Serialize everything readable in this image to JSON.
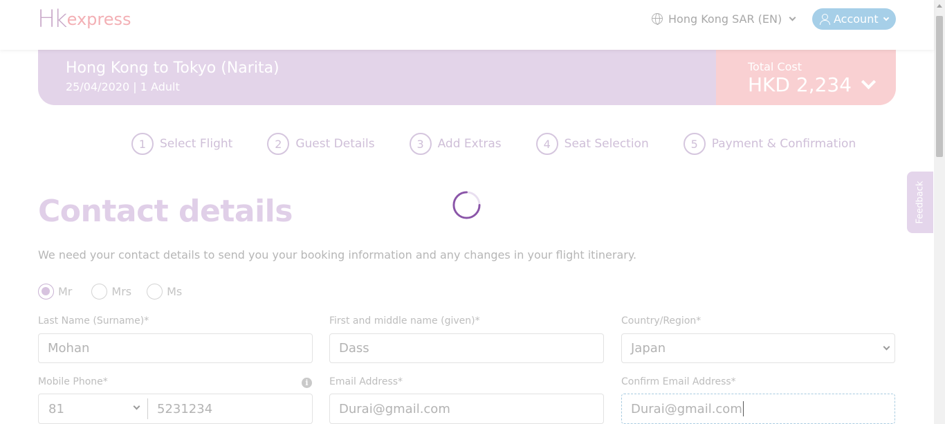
{
  "header": {
    "logo_hk": "Hk",
    "logo_express": "express",
    "region_label": "Hong Kong SAR (EN)",
    "account_label": "Account"
  },
  "trip": {
    "route": "Hong Kong to Tokyo (Narita)",
    "meta": "25/04/2020 | 1 Adult",
    "total_label": "Total Cost",
    "total_value": "HKD 2,234"
  },
  "steps": [
    {
      "num": "1",
      "label": "Select Flight"
    },
    {
      "num": "2",
      "label": "Guest Details"
    },
    {
      "num": "3",
      "label": "Add Extras"
    },
    {
      "num": "4",
      "label": "Seat Selection"
    },
    {
      "num": "5",
      "label": "Payment & Confirmation"
    }
  ],
  "feedback_label": "Feedback",
  "form": {
    "title": "Contact details",
    "intro": "We need your contact details to send you your booking information and any changes in your flight itinerary.",
    "salutations": [
      {
        "label": "Mr",
        "checked": true
      },
      {
        "label": "Mrs",
        "checked": false
      },
      {
        "label": "Ms",
        "checked": false
      }
    ],
    "last_name": {
      "label": "Last Name (Surname)*",
      "value": "Mohan"
    },
    "first_name": {
      "label": "First and middle name (given)*",
      "value": "Dass"
    },
    "country": {
      "label": "Country/Region*",
      "value": "Japan"
    },
    "mobile": {
      "label": "Mobile Phone*",
      "code": "81",
      "number": "5231234"
    },
    "email": {
      "label": "Email Address*",
      "value": "Durai@gmail.com"
    },
    "confirm_email": {
      "label": "Confirm Email Address*",
      "value": "Durai@gmail.com"
    }
  },
  "colors": {
    "brand_purple": "#e3d4e9",
    "brand_pink": "#f9d0d2",
    "account_blue": "#a6cfe8",
    "spinner": "#8a55a8"
  }
}
